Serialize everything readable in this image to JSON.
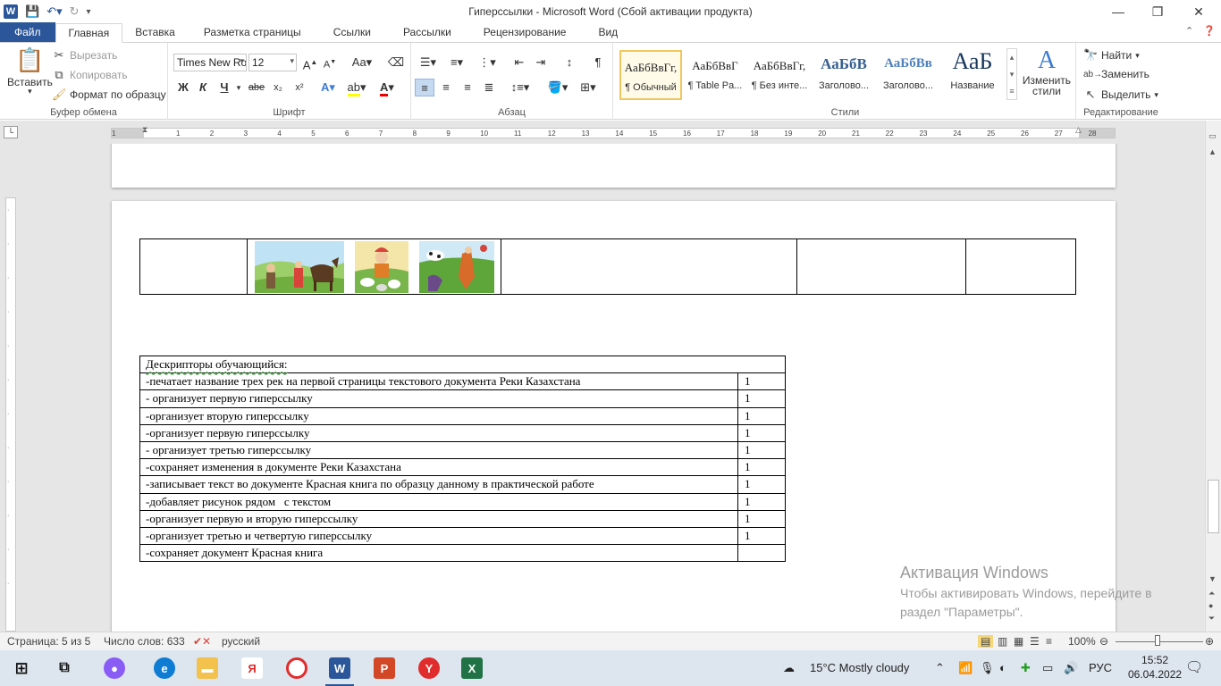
{
  "window": {
    "title": "Гиперссылки  -  Microsoft Word (Сбой активации продукта)",
    "app_badge": "W"
  },
  "tabs": [
    "Файл",
    "Главная",
    "Вставка",
    "Разметка страницы",
    "Ссылки",
    "Рассылки",
    "Рецензирование",
    "Вид"
  ],
  "clipboard": {
    "paste": "Вставить",
    "cut": "Вырезать",
    "copy": "Копировать",
    "format_painter": "Формат по образцу",
    "label": "Буфер обмена"
  },
  "font": {
    "family": "Times New Ro",
    "size": "12",
    "label": "Шрифт",
    "bold": "Ж",
    "italic": "К",
    "underline": "Ч",
    "strike": "abe",
    "sub": "x₂",
    "sup": "x²"
  },
  "paragraph": {
    "label": "Абзац"
  },
  "styles": {
    "label": "Стили",
    "items": [
      {
        "sample": "АаБбВвГг,",
        "name": "¶ Обычный"
      },
      {
        "sample": "АаБбВвГ",
        "name": "¶ Table Pa..."
      },
      {
        "sample": "АаБбВвГг,",
        "name": "¶ Без инте..."
      },
      {
        "sample": "АаБбВ",
        "name": "Заголово..."
      },
      {
        "sample": "АаБбВв",
        "name": "Заголово..."
      },
      {
        "sample": "АаБ",
        "name": "Название"
      }
    ],
    "change": "Изменить стили"
  },
  "editing": {
    "find": "Найти",
    "replace": "Заменить",
    "select": "Выделить",
    "label": "Редактирование"
  },
  "ruler": {
    "ticks": [
      "1",
      "1",
      "2",
      "3",
      "4",
      "5",
      "6",
      "7",
      "8",
      "9",
      "10",
      "11",
      "12",
      "13",
      "14",
      "15",
      "16",
      "17",
      "18",
      "19",
      "20",
      "21",
      "22",
      "23",
      "24",
      "25",
      "26",
      "27",
      "28"
    ]
  },
  "descriptors": {
    "header": "Дескрипторы обучающийся:",
    "rows": [
      {
        "text": "-печатает название трех рек на первой страницы текстового документа Реки Казахстана",
        "score": "1"
      },
      {
        "text": "- организует первую гиперссылку",
        "score": "1"
      },
      {
        "text": "-организует вторую гиперссылку",
        "score": "1"
      },
      {
        "text": "-организует первую гиперссылку",
        "score": "1"
      },
      {
        "text": "- организует третью гиперссылку",
        "score": "1"
      },
      {
        "text": "-сохраняет изменения в документе Реки Казахстана",
        "score": "1"
      },
      {
        "text": "-записывает текст во документе Красная книга по образцу данному в практической работе",
        "score": "1"
      },
      {
        "text": "-добавляет рисунок рядом   с текстом",
        "score": "1"
      },
      {
        "text": "-организует первую и вторую гиперссылку",
        "score": "1"
      },
      {
        "text": "-организует третью и четвертую гиперссылку",
        "score": "1"
      },
      {
        "text": "-сохраняет документ Красная книга",
        "score": ""
      }
    ]
  },
  "activation": {
    "title": "Активация Windows",
    "text": "Чтобы активировать Windows, перейдите в раздел \"Параметры\"."
  },
  "status": {
    "page": "Страница: 5 из 5",
    "words": "Число слов: 633",
    "language": "русский",
    "zoom": "100%"
  },
  "taskbar": {
    "weather": "15°C  Mostly cloudy",
    "lang": "РУС",
    "time": "15:52",
    "date": "06.04.2022"
  },
  "colors": {
    "word_blue": "#2b579a",
    "canvas_gray": "#e6e6e6"
  }
}
